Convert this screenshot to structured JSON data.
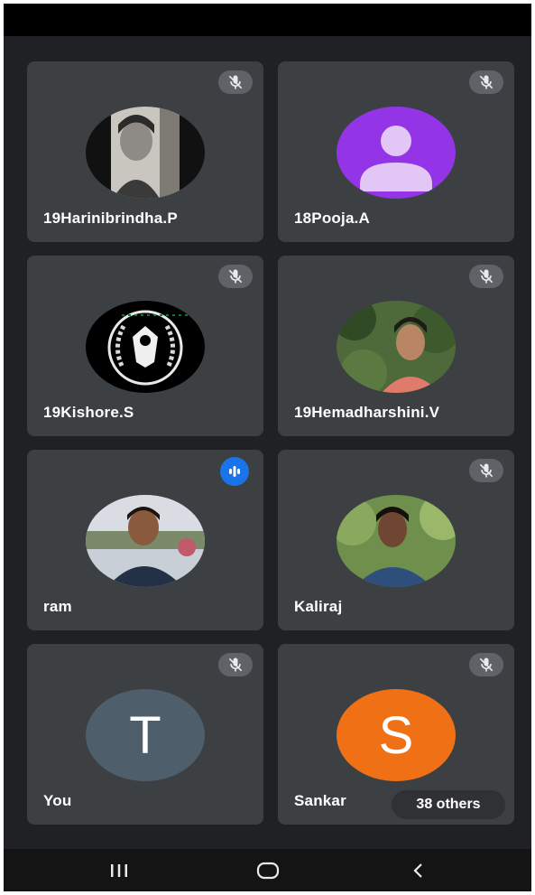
{
  "participants": [
    {
      "name": "19Harinibrindha.P",
      "mic": "muted",
      "avatar": "photo"
    },
    {
      "name": "18Pooja.A",
      "mic": "muted",
      "avatar": "default-person",
      "avatar_color": "#9334e6"
    },
    {
      "name": "19Kishore.S",
      "mic": "muted",
      "avatar": "emblem"
    },
    {
      "name": "19Hemadharshini.V",
      "mic": "muted",
      "avatar": "photo"
    },
    {
      "name": "ram",
      "mic": "speaking",
      "avatar": "photo"
    },
    {
      "name": "Kaliraj",
      "mic": "muted",
      "avatar": "photo"
    },
    {
      "name": "You",
      "mic": "muted",
      "avatar": "initial",
      "initial": "T",
      "avatar_color": "#4e5e6b"
    },
    {
      "name": "Sankar",
      "mic": "muted",
      "avatar": "initial",
      "initial": "S",
      "avatar_color": "#f07016"
    }
  ],
  "others_badge": "38 others",
  "colors": {
    "background": "#202124",
    "tile": "#3c4043",
    "speaking": "#1a73e8"
  },
  "nav": [
    "recents-icon",
    "home-icon",
    "back-icon"
  ]
}
